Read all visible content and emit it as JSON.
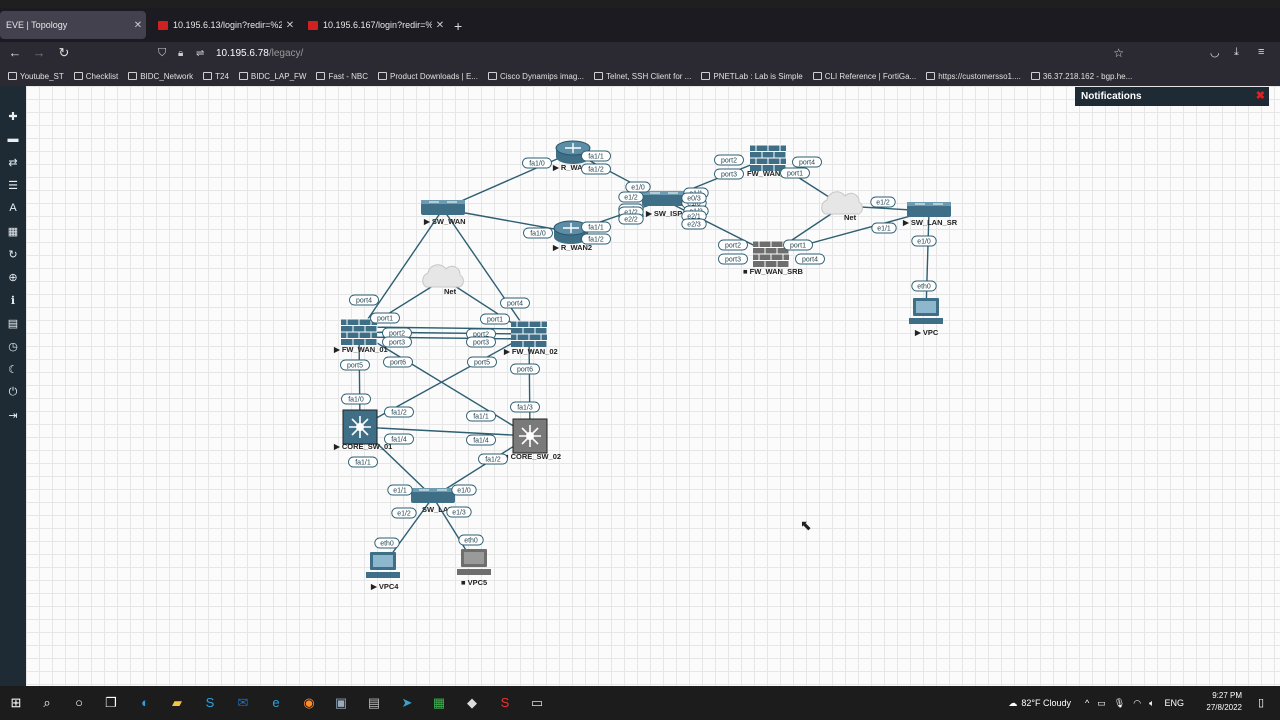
{
  "tabs": [
    {
      "label": "EVE | Topology"
    },
    {
      "label": "10.195.6.13/login?redir=%2Fng"
    },
    {
      "label": "10.195.6.167/login?redir=%2Fng"
    }
  ],
  "url": {
    "host": "10.195.6.78",
    "path": "/legacy/"
  },
  "bookmarks": [
    "Youtube_ST",
    "Checklist",
    "BIDC_Network",
    "T24",
    "BIDC_LAP_FW",
    "Fast - NBC",
    "Product Downloads | E...",
    "Cisco Dynamips imag...",
    "Telnet, SSH Client for ...",
    "PNETLab : Lab is Simple",
    "CLI Reference | FortiGa...",
    "https://customersso1....",
    "36.37.218.162 - bgp.he..."
  ],
  "notifications": {
    "title": "Notifications"
  },
  "nodes": [
    {
      "label": "R_WAN",
      "marker": "▶",
      "icon": "router-icon"
    },
    {
      "label": "R_WAN2",
      "marker": "▶",
      "icon": "router-icon"
    },
    {
      "label": "SW_WAN",
      "marker": "▶",
      "icon": "switch-icon"
    },
    {
      "label": "SW_ISP",
      "marker": "▶",
      "icon": "switch-icon"
    },
    {
      "label": "FW_WAN_",
      "marker": "",
      "icon": "firewall-icon"
    },
    {
      "label": "FW_WAN_SRB",
      "marker": "■",
      "icon": "firewall-icon"
    },
    {
      "label": "SW_LAN_SR",
      "marker": "▶",
      "icon": "switch-icon"
    },
    {
      "label": "VPC",
      "marker": "▶",
      "icon": "pc-icon"
    },
    {
      "label": "Net",
      "marker": "",
      "icon": "cloud-icon"
    },
    {
      "label": "Net",
      "marker": "",
      "icon": "cloud-icon"
    },
    {
      "label": "FW_WAN_01",
      "marker": "▶",
      "icon": "firewall-icon"
    },
    {
      "label": "FW_WAN_02",
      "marker": "▶",
      "icon": "firewall-icon"
    },
    {
      "label": "CORE_SW_01",
      "marker": "▶",
      "icon": "l3-switch-icon"
    },
    {
      "label": "CORE_SW_02",
      "marker": "■",
      "icon": "l3-switch-icon"
    },
    {
      "label": "SW_LAN",
      "marker": "",
      "icon": "switch-icon"
    },
    {
      "label": "VPC4",
      "marker": "▶",
      "icon": "pc-icon"
    },
    {
      "label": "VPC5",
      "marker": "■",
      "icon": "pc-icon"
    }
  ],
  "port_labels": [
    "fa1/0",
    "fa1/1",
    "fa1/2",
    "e1/0",
    "e1/2",
    "e1/3",
    "e1/1",
    "e1/0",
    "fa1/0",
    "fa1/1",
    "fa1/2",
    "e2/0",
    "e1/2",
    "e2/2",
    "e0/3",
    "e1/3",
    "e2/1",
    "e2/3",
    "port2",
    "port3",
    "port4",
    "port1",
    "port2",
    "port3",
    "port1",
    "port4",
    "e1/2",
    "e1/1",
    "e1/0",
    "eth0",
    "port4",
    "port1",
    "port4",
    "port1",
    "port2",
    "port3",
    "port2",
    "port3",
    "port6",
    "port5",
    "port5",
    "port6",
    "fa1/0",
    "fa1/3",
    "fa1/2",
    "fa1/1",
    "fa1/4",
    "fa1/4",
    "fa1/1",
    "fa1/2",
    "e1/1",
    "e1/0",
    "e1/2",
    "e1/3",
    "eth0",
    "eth0"
  ],
  "taskbar": {
    "weather": "82°F  Cloudy",
    "lang": "ENG",
    "time": "9:27 PM",
    "date": "27/8/2022"
  },
  "colors": {
    "canvas_bg": "#fbfbfb",
    "sidebar": "#1e2b35",
    "device": "#3f6f86",
    "link": "#2d5e72",
    "close": "#e02020"
  }
}
